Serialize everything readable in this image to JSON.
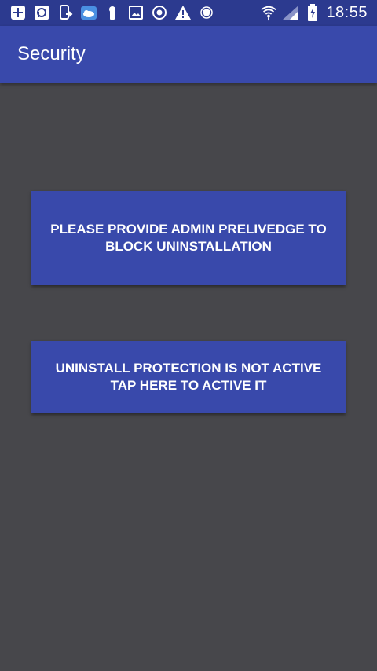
{
  "status_bar": {
    "time": "18:55",
    "left_icons": [
      "add-box-icon",
      "parking-icon",
      "phone-forward-icon",
      "weather-icon",
      "keyhole-icon",
      "image-icon",
      "sync-icon",
      "warning-icon",
      "shield-icon"
    ],
    "right_icons": [
      "wifi-icon",
      "signal-icon",
      "battery-charging-icon"
    ]
  },
  "app_bar": {
    "title": "Security"
  },
  "actions": {
    "admin_privilege": "PLEASE PROVIDE ADMIN PRELIVEDGE TO\nBLOCK UNINSTALLATION",
    "uninstall_protection": "UNINSTALL PROTECTION IS NOT ACTIVE\nTAP HERE TO ACTIVE IT"
  },
  "colors": {
    "status_bar": "#2c3a8f",
    "app_bar": "#3949ab",
    "background": "#47474b",
    "button": "#3949ab",
    "text": "#ffffff"
  }
}
